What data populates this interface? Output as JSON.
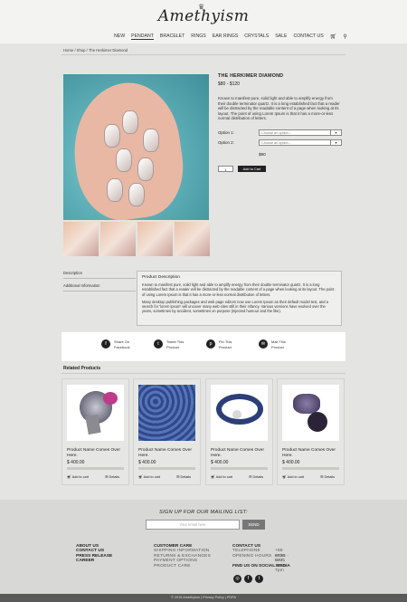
{
  "brand": {
    "logo_text": "Amethyism"
  },
  "nav": {
    "items": [
      {
        "label": "NEW",
        "active": false
      },
      {
        "label": "PENDANT",
        "active": true
      },
      {
        "label": "BRACELET",
        "active": false
      },
      {
        "label": "RINGS",
        "active": false
      },
      {
        "label": "EAR RINGS",
        "active": false
      },
      {
        "label": "CRYSTALS",
        "active": false
      },
      {
        "label": "SALE",
        "active": false
      },
      {
        "label": "CONTACT US",
        "active": false
      }
    ],
    "cart_icon": "cart-icon",
    "search_icon": "search-icon"
  },
  "breadcrumb": "Home / Shop / The Herkimer Diamond",
  "product": {
    "title": "THE HERKIMER DIAMOND",
    "price": "$80 - $120",
    "description": "Known to manifest pure, solid light and able to amplify energy from their double terminator quartz. It is a long established fact that a reader will be distracted by the readable content of a page when looking at its layout. The point of using Lorem Ipsum is that it has a more-or-less normal distribution of letters.",
    "option1_label": "Option 1:",
    "option1_placeholder": "Choose an option...",
    "option2_label": "Option 2:",
    "option2_placeholder": "Choose an option...",
    "selected_price": "$90",
    "quantity": "1",
    "add_to_cart": "Add to Cart"
  },
  "tabs": {
    "description": "Description",
    "additional": "Additional Information",
    "box_title": "Product Description",
    "para1": "Known to manifest pure, solid light and able to amplify energy from their double terminator quartz. It is a long established fact that a reader will be distracted by the readable content of a page when looking at its layout. The point of using Lorem Ipsum is that it has a more-or-less normal distribution of letters.",
    "para2": "Many desktop publishing packages and web page editors now use Lorem Ipsum as their default model text, and a search for 'lorem ipsum' will uncover many web sites still in their infancy. Various versions have evolved over the years, sometimes by accident, sometimes on purpose (injected humour and the like)."
  },
  "share": [
    {
      "icon": "facebook-icon",
      "glyph": "f",
      "line1": "Share On",
      "line2": "Facebook"
    },
    {
      "icon": "twitter-icon",
      "glyph": "t",
      "line1": "Tweet This",
      "line2": "Product"
    },
    {
      "icon": "pinterest-icon",
      "glyph": "p",
      "line1": "Pin This",
      "line2": "Product"
    },
    {
      "icon": "mail-icon",
      "glyph": "✉",
      "line1": "Mail This",
      "line2": "Product"
    }
  ],
  "related": {
    "title": "Related Products",
    "products": [
      {
        "name": "Product Name Comes Over Here.",
        "price": "$ 400.00",
        "add": "Add to cart",
        "details": "Details"
      },
      {
        "name": "Product Name Comes Over Here.",
        "price": "$ 400.00",
        "add": "Add to cart",
        "details": "Details"
      },
      {
        "name": "Product Name Comes Over Here.",
        "price": "$ 400.00",
        "add": "Add to cart",
        "details": "Details"
      },
      {
        "name": "Product Name Comes Over Here.",
        "price": "$ 400.00",
        "add": "Add to cart",
        "details": "Details"
      }
    ]
  },
  "footer": {
    "signup_title": "SIGN UP FOR OUR MAILING LIST:",
    "email_placeholder": "Your email here",
    "send": "SEND",
    "col1": [
      "ABOUT US",
      "CONTACT US",
      "PRESS RELEASE",
      "CAREER"
    ],
    "col2_title": "CUSTOMER CARE",
    "col2": [
      "SHIPPING INFORMATION",
      "RETURNS & EXCHANGES",
      "PAYMENT OPTIONS",
      "PRODUCT CARE"
    ],
    "col3_title": "CONTACT US",
    "telephone_label": "TELEPHONE",
    "telephone": "+65 6702 0221",
    "hours_label": "OPENING HOURS",
    "hours": "MON - SAT, 11am - 7pm",
    "social_title": "FIND US ON SOCIAL MEDIA",
    "social": [
      "instagram-icon",
      "facebook-icon",
      "twitter-icon"
    ],
    "copyright": "© 2015 Amethyism  |  Privacy Policy  |  PDPA"
  },
  "colors": {
    "background": "#e4e4e2",
    "accent": "#222222",
    "footer": "#d8d8d6"
  }
}
